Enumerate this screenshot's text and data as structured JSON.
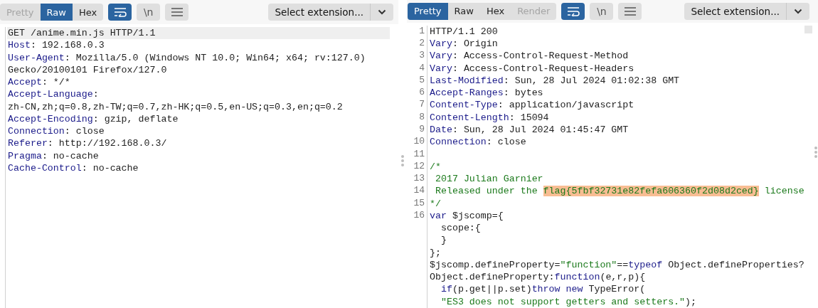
{
  "request": {
    "toolbar": {
      "tabs": [
        {
          "label": "Pretty",
          "selected": false,
          "disabled": true
        },
        {
          "label": "Raw",
          "selected": true,
          "disabled": false
        },
        {
          "label": "Hex",
          "selected": false,
          "disabled": false
        }
      ],
      "wrap_on": true,
      "newline_label": "\\n",
      "extension_select": "Select extension..."
    },
    "lines": [
      {
        "current": true,
        "segments": [
          {
            "kind": "plain",
            "text": "GET /anime.min.js HTTP/1.1"
          }
        ]
      },
      {
        "current": false,
        "segments": [
          {
            "kind": "key",
            "text": "Host"
          },
          {
            "kind": "plain",
            "text": ": 192.168.0.3"
          }
        ]
      },
      {
        "current": false,
        "segments": [
          {
            "kind": "key",
            "text": "User-Agent"
          },
          {
            "kind": "plain",
            "text": ": Mozilla/5.0 (Windows NT 10.0; Win64; x64; rv:127.0)"
          }
        ]
      },
      {
        "current": false,
        "segments": [
          {
            "kind": "plain",
            "text": "Gecko/20100101 Firefox/127.0"
          }
        ]
      },
      {
        "current": false,
        "segments": [
          {
            "kind": "key",
            "text": "Accept"
          },
          {
            "kind": "plain",
            "text": ": */*"
          }
        ]
      },
      {
        "current": false,
        "segments": [
          {
            "kind": "key",
            "text": "Accept-Language"
          },
          {
            "kind": "plain",
            "text": ":"
          }
        ]
      },
      {
        "current": false,
        "segments": [
          {
            "kind": "plain",
            "text": "zh-CN,zh;q=0.8,zh-TW;q=0.7,zh-HK;q=0.5,en-US;q=0.3,en;q=0.2"
          }
        ]
      },
      {
        "current": false,
        "segments": [
          {
            "kind": "key",
            "text": "Accept-Encoding"
          },
          {
            "kind": "plain",
            "text": ": gzip, deflate"
          }
        ]
      },
      {
        "current": false,
        "segments": [
          {
            "kind": "key",
            "text": "Connection"
          },
          {
            "kind": "plain",
            "text": ": close"
          }
        ]
      },
      {
        "current": false,
        "segments": [
          {
            "kind": "key",
            "text": "Referer"
          },
          {
            "kind": "plain",
            "text": ": http://192.168.0.3/"
          }
        ]
      },
      {
        "current": false,
        "segments": [
          {
            "kind": "key",
            "text": "Pragma"
          },
          {
            "kind": "plain",
            "text": ": no-cache"
          }
        ]
      },
      {
        "current": false,
        "segments": [
          {
            "kind": "key",
            "text": "Cache-Control"
          },
          {
            "kind": "plain",
            "text": ": no-cache"
          }
        ]
      }
    ]
  },
  "response": {
    "toolbar": {
      "tabs": [
        {
          "label": "Pretty",
          "selected": true,
          "disabled": false
        },
        {
          "label": "Raw",
          "selected": false,
          "disabled": false
        },
        {
          "label": "Hex",
          "selected": false,
          "disabled": false
        },
        {
          "label": "Render",
          "selected": false,
          "disabled": true
        }
      ],
      "wrap_on": true,
      "newline_label": "\\n",
      "extension_select": "Select extension..."
    },
    "lines": [
      {
        "number": "1",
        "segments": [
          {
            "kind": "plain",
            "text": "HTTP/1.1 200"
          }
        ]
      },
      {
        "number": "2",
        "segments": [
          {
            "kind": "key",
            "text": "Vary"
          },
          {
            "kind": "plain",
            "text": ": Origin"
          }
        ]
      },
      {
        "number": "3",
        "segments": [
          {
            "kind": "key",
            "text": "Vary"
          },
          {
            "kind": "plain",
            "text": ": Access-Control-Request-Method"
          }
        ]
      },
      {
        "number": "4",
        "segments": [
          {
            "kind": "key",
            "text": "Vary"
          },
          {
            "kind": "plain",
            "text": ": Access-Control-Request-Headers"
          }
        ]
      },
      {
        "number": "5",
        "segments": [
          {
            "kind": "key",
            "text": "Last-Modified"
          },
          {
            "kind": "plain",
            "text": ": Sun, 28 Jul 2024 01:02:38 GMT"
          }
        ]
      },
      {
        "number": "6",
        "segments": [
          {
            "kind": "key",
            "text": "Accept-Ranges"
          },
          {
            "kind": "plain",
            "text": ": bytes"
          }
        ]
      },
      {
        "number": "7",
        "segments": [
          {
            "kind": "key",
            "text": "Content-Type"
          },
          {
            "kind": "plain",
            "text": ": application/javascript"
          }
        ]
      },
      {
        "number": "8",
        "segments": [
          {
            "kind": "key",
            "text": "Content-Length"
          },
          {
            "kind": "plain",
            "text": ": 15094"
          }
        ]
      },
      {
        "number": "9",
        "segments": [
          {
            "kind": "key",
            "text": "Date"
          },
          {
            "kind": "plain",
            "text": ": Sun, 28 Jul 2024 01:45:47 GMT"
          }
        ]
      },
      {
        "number": "10",
        "segments": [
          {
            "kind": "key",
            "text": "Connection"
          },
          {
            "kind": "plain",
            "text": ": close"
          }
        ]
      },
      {
        "number": "11"
      },
      {
        "number": "12",
        "segments": [
          {
            "kind": "comment",
            "text": "/*"
          }
        ]
      },
      {
        "number": "13",
        "segments": [
          {
            "kind": "comment",
            "text": " 2017 Julian Garnier"
          }
        ]
      },
      {
        "number": "14",
        "segments": [
          {
            "kind": "comment",
            "text": " Released under the "
          },
          {
            "kind": "highlight",
            "text": "flag{5fbf32731e82fefa606360f2d08d2ced}"
          },
          {
            "kind": "comment",
            "text": " license"
          }
        ]
      },
      {
        "number": "15",
        "segments": [
          {
            "kind": "comment",
            "text": "*/"
          }
        ]
      },
      {
        "number": "16",
        "segments": [
          {
            "kind": "keyword",
            "text": "var"
          },
          {
            "kind": "plain",
            "text": " $jscomp={"
          }
        ]
      },
      {
        "segments": [
          {
            "kind": "plain",
            "text": "  scope:{"
          }
        ]
      },
      {
        "segments": [
          {
            "kind": "plain",
            "text": "  }"
          }
        ]
      },
      {
        "segments": [
          {
            "kind": "plain",
            "text": "};"
          }
        ]
      },
      {
        "segments": [
          {
            "kind": "plain",
            "text": "$jscomp.defineProperty="
          },
          {
            "kind": "string",
            "text": "\"function\""
          },
          {
            "kind": "plain",
            "text": "=="
          },
          {
            "kind": "keyword",
            "text": "typeof"
          },
          {
            "kind": "plain",
            "text": " Object.defineProperties?"
          }
        ]
      },
      {
        "segments": [
          {
            "kind": "plain",
            "text": "Object.defineProperty:"
          },
          {
            "kind": "keyword",
            "text": "function"
          },
          {
            "kind": "plain",
            "text": "(e,r,p){"
          }
        ]
      },
      {
        "segments": [
          {
            "kind": "keyword",
            "text": "  if"
          },
          {
            "kind": "plain",
            "text": "(p.get||p.set)"
          },
          {
            "kind": "keyword",
            "text": "throw new"
          },
          {
            "kind": "plain",
            "text": " TypeError("
          }
        ]
      },
      {
        "segments": [
          {
            "kind": "string",
            "text": "  \"ES3 does not support getters and setters.\""
          },
          {
            "kind": "plain",
            "text": ");"
          }
        ]
      }
    ]
  }
}
